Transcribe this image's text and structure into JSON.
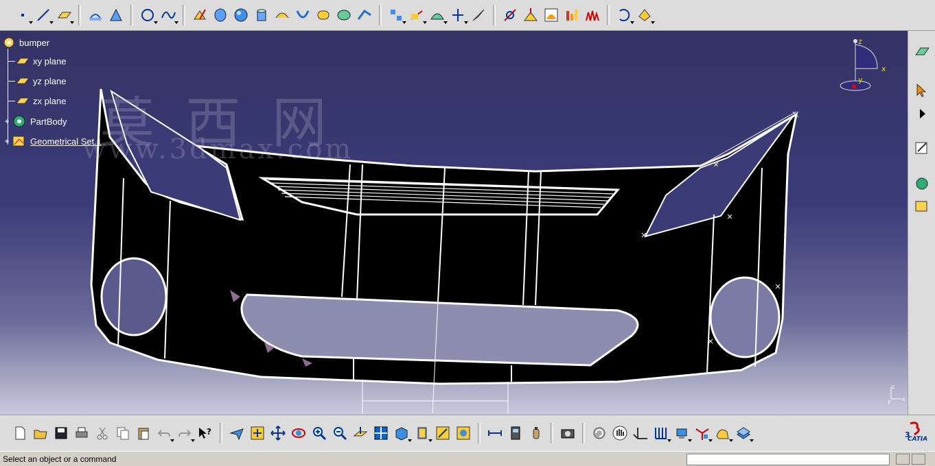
{
  "tree": {
    "root": "bumper",
    "items": [
      {
        "label": "xy plane",
        "icon": "plane-icon",
        "expander": false
      },
      {
        "label": "yz plane",
        "icon": "plane-icon",
        "expander": false
      },
      {
        "label": "zx plane",
        "icon": "plane-icon",
        "expander": false
      },
      {
        "label": "PartBody",
        "icon": "partbody-gear-icon",
        "expander": true
      },
      {
        "label": "Geometrical Set.1",
        "icon": "geometrical-set-icon",
        "expander": true
      }
    ]
  },
  "watermark": {
    "chars": "莫 西 网",
    "url": "www.3dmax.com"
  },
  "compass": {
    "z": "z",
    "x": "x",
    "y": "y"
  },
  "mini_axis": {
    "z": "z",
    "x": "x",
    "y": "y"
  },
  "status": {
    "message": "Select an object or a command"
  },
  "brand": {
    "logo": "CATIA"
  },
  "colors": {
    "viewport_top": "#333366",
    "viewport_bottom": "#c9c9dc",
    "toolbar": "#dcdcdc",
    "geometry_fill": "#000000",
    "geometry_edge": "#ffffff"
  }
}
